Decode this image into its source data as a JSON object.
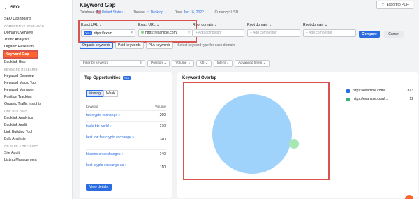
{
  "sidebar": {
    "app_label": "SEO",
    "items": [
      {
        "type": "item",
        "label": "SEO Dashboard"
      },
      {
        "type": "section",
        "label": "COMPETITIVE RESEARCH"
      },
      {
        "type": "item",
        "label": "Domain Overview"
      },
      {
        "type": "item",
        "label": "Traffic Analytics"
      },
      {
        "type": "item",
        "label": "Organic Research"
      },
      {
        "type": "item",
        "label": "Keyword Gap",
        "active": true
      },
      {
        "type": "item",
        "label": "Backlink Gap"
      },
      {
        "type": "section",
        "label": "KEYWORD RESEARCH"
      },
      {
        "type": "item",
        "label": "Keyword Overview"
      },
      {
        "type": "item",
        "label": "Keyword Magic Tool"
      },
      {
        "type": "item",
        "label": "Keyword Manager"
      },
      {
        "type": "item",
        "label": "Position Tracking"
      },
      {
        "type": "item",
        "label": "Organic Traffic Insights"
      },
      {
        "type": "section",
        "label": "LINK BUILDING"
      },
      {
        "type": "item",
        "label": "Backlink Analytics"
      },
      {
        "type": "item",
        "label": "Backlink Audit"
      },
      {
        "type": "item",
        "label": "Link Building Tool"
      },
      {
        "type": "item",
        "label": "Bulk Analysis"
      },
      {
        "type": "section",
        "label": "ON PAGE & TECH SEO"
      },
      {
        "type": "item",
        "label": "Site Audit"
      },
      {
        "type": "item",
        "label": "Listing Management"
      }
    ]
  },
  "header": {
    "title": "Keyword Gap",
    "export_label": "Export to PDF",
    "database_label": "Database:",
    "database_value": "United States",
    "device_label": "Device:",
    "device_value": "Desktop",
    "date_label": "Date:",
    "date_value": "Jun 16, 2022",
    "currency": "Currency: USD"
  },
  "domains": {
    "cols": [
      {
        "label": "Exact URL",
        "value": "https://exam",
        "tag": "You"
      },
      {
        "label": "Exact URL",
        "value": "https://example.com/",
        "tag": "dot"
      },
      {
        "label": "Root domain",
        "placeholder": "Add competitor"
      },
      {
        "label": "Root domain",
        "placeholder": "Add competitor"
      },
      {
        "label": "Root domain",
        "placeholder": "Add competitor"
      }
    ],
    "compare_label": "Compare",
    "cancel_label": "Cancel"
  },
  "keyword_tabs": {
    "tabs": [
      "Organic keywords",
      "Paid keywords",
      "PLA keywords"
    ],
    "hint": "Select keyword type for each domain"
  },
  "sub_filters": {
    "search_placeholder": "Filter by keyword",
    "buttons": [
      "Position",
      "Volume",
      "KD",
      "Intent",
      "Advanced filters"
    ]
  },
  "opportunities": {
    "title": "Top Opportunities",
    "you_badge": "You",
    "toggle": [
      "Missing",
      "Weak"
    ],
    "col_keyword": "Keyword",
    "col_volume": "Volume",
    "rows": [
      {
        "keyword": "top crypto exchange »",
        "volume": "260"
      },
      {
        "keyword": "trade btc world »",
        "volume": "170"
      },
      {
        "keyword": "best low fee crypto exchange »",
        "volume": "140"
      },
      {
        "keyword": "bitcoins on exchanges »",
        "volume": "140"
      },
      {
        "keyword": "best crypto exchange us »",
        "volume": "110"
      }
    ],
    "view_label": "View details"
  },
  "overlap": {
    "title": "Keyword Overlap",
    "legend": [
      {
        "label": "https://example.com/...",
        "count": "613",
        "color": "#2b6de0"
      },
      {
        "label": "https://example.com/...",
        "count": "12",
        "color": "#3bb273"
      }
    ]
  }
}
